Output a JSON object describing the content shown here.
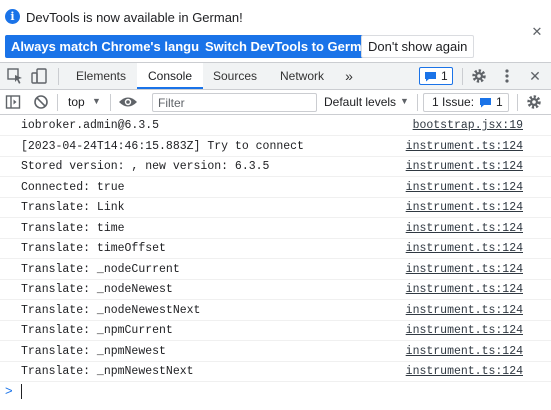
{
  "infobar": {
    "icon": "info-icon",
    "message": "DevTools is now available in German!",
    "buttons": {
      "match_language": "Always match Chrome's language",
      "switch_german": "Switch DevTools to German",
      "dont_show": "Don't show again"
    },
    "close": "close-icon"
  },
  "tabbar": {
    "tabs": [
      "Elements",
      "Console",
      "Sources",
      "Network"
    ],
    "active_tab": "Console",
    "more_tabs": "»",
    "message_count": "1"
  },
  "console_toolbar": {
    "context": "top",
    "filter_placeholder": "Filter",
    "levels": "Default levels",
    "issues_label": "1 Issue:",
    "issues_count": "1"
  },
  "log": [
    {
      "message": "iobroker.admin@6.3.5",
      "source": "bootstrap.jsx:19"
    },
    {
      "message": "[2023-04-24T14:46:15.883Z] Try to connect",
      "source": "instrument.ts:124"
    },
    {
      "message": "Stored version: , new version: 6.3.5",
      "source": "instrument.ts:124"
    },
    {
      "message": "Connected: true",
      "source": "instrument.ts:124"
    },
    {
      "message": "Translate: Link",
      "source": "instrument.ts:124"
    },
    {
      "message": "Translate: time",
      "source": "instrument.ts:124"
    },
    {
      "message": "Translate: timeOffset",
      "source": "instrument.ts:124"
    },
    {
      "message": "Translate: _nodeCurrent",
      "source": "instrument.ts:124"
    },
    {
      "message": "Translate: _nodeNewest",
      "source": "instrument.ts:124"
    },
    {
      "message": "Translate: _nodeNewestNext",
      "source": "instrument.ts:124"
    },
    {
      "message": "Translate: _npmCurrent",
      "source": "instrument.ts:124"
    },
    {
      "message": "Translate: _npmNewest",
      "source": "instrument.ts:124"
    },
    {
      "message": "Translate: _npmNewestNext",
      "source": "instrument.ts:124"
    }
  ],
  "prompt": ">",
  "colors": {
    "accent": "#1a73e8",
    "border": "#cbcdd1",
    "toolbar_bg": "#f1f3f4"
  }
}
